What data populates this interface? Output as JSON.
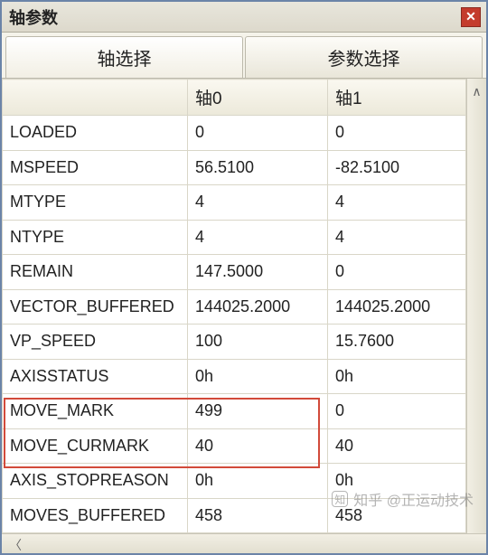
{
  "window": {
    "title": "轴参数"
  },
  "tabs": {
    "axis_select": "轴选择",
    "param_select": "参数选择"
  },
  "columns": {
    "name": "",
    "axis0": "轴0",
    "axis1": "轴1"
  },
  "rows": [
    {
      "name": "LOADED",
      "a0": "0",
      "a1": "0"
    },
    {
      "name": "MSPEED",
      "a0": "56.5100",
      "a1": "-82.5100"
    },
    {
      "name": "MTYPE",
      "a0": "4",
      "a1": "4"
    },
    {
      "name": "NTYPE",
      "a0": "4",
      "a1": "4"
    },
    {
      "name": "REMAIN",
      "a0": "147.5000",
      "a1": "0"
    },
    {
      "name": "VECTOR_BUFFERED",
      "a0": "144025.2000",
      "a1": "144025.2000"
    },
    {
      "name": "VP_SPEED",
      "a0": "100",
      "a1": "15.7600"
    },
    {
      "name": "AXISSTATUS",
      "a0": "0h",
      "a1": "0h"
    },
    {
      "name": "MOVE_MARK",
      "a0": "499",
      "a1": "0"
    },
    {
      "name": "MOVE_CURMARK",
      "a0": "40",
      "a1": "40"
    },
    {
      "name": "AXIS_STOPREASON",
      "a0": "0h",
      "a1": "0h"
    },
    {
      "name": "MOVES_BUFFERED",
      "a0": "458",
      "a1": "458"
    }
  ],
  "watermark": "知乎 @正运动技术"
}
